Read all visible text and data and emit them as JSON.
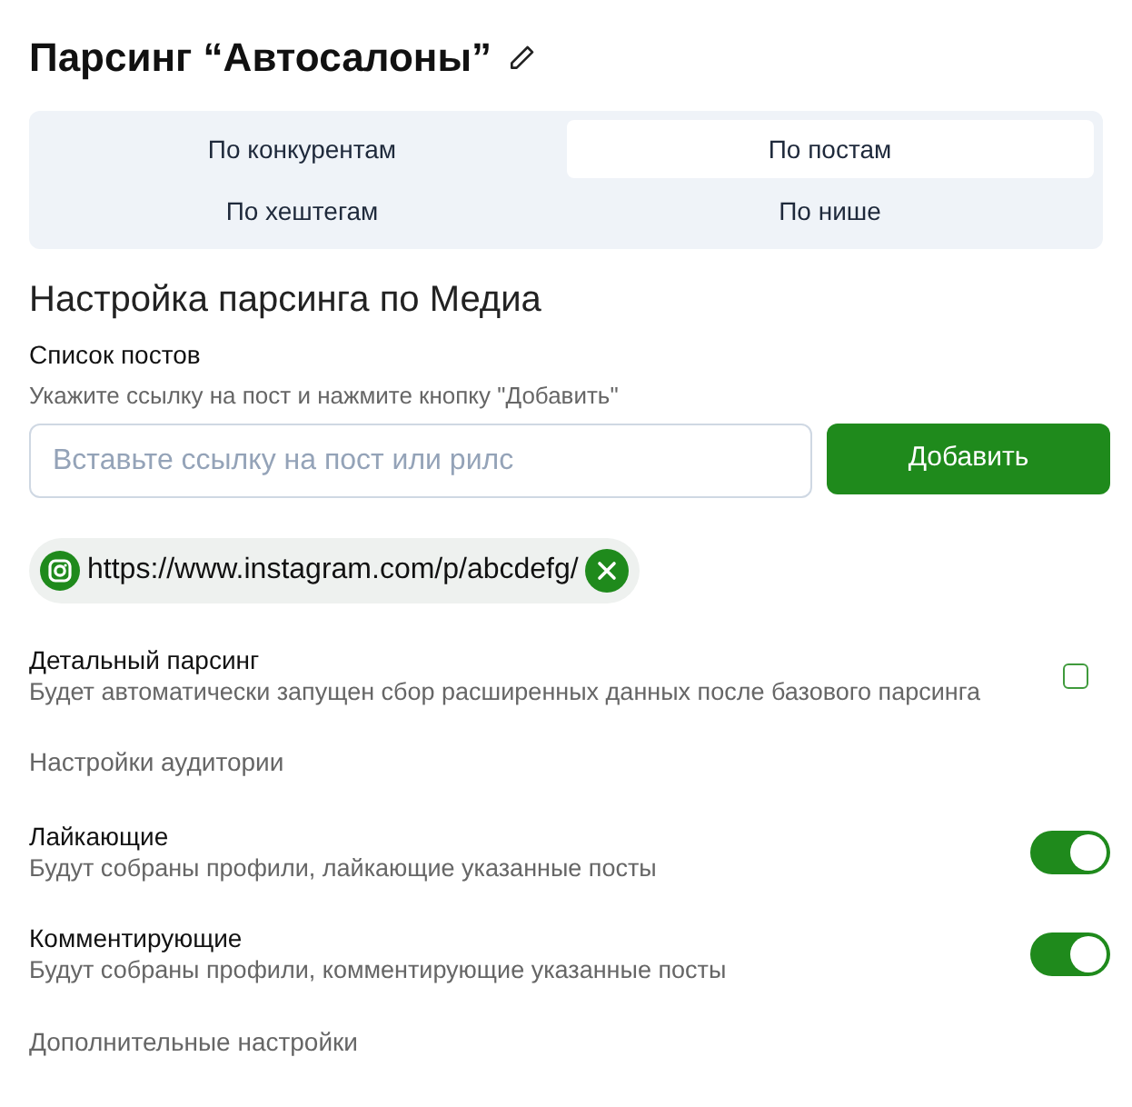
{
  "title": "Парсинг “Автосалоны”",
  "tabs": [
    {
      "label": "По конкурентам",
      "selected": false
    },
    {
      "label": "По постам",
      "selected": true
    },
    {
      "label": "По хештегам",
      "selected": false
    },
    {
      "label": "По нише",
      "selected": false
    }
  ],
  "section_title": "Настройка парсинга по Медиа",
  "posts": {
    "label": "Список постов",
    "hint": "Укажите ссылку на пост и нажмите кнопку \"Добавить\"",
    "placeholder": "Вставьте ссылку на пост или рилс",
    "add_button": "Добавить",
    "items": [
      {
        "url": "https://www.instagram.com/p/abcdefg/"
      }
    ]
  },
  "detailed": {
    "title": "Детальный парсинг",
    "description": "Будет автоматически запущен сбор расширенных данных после базового парсинга",
    "checked": false
  },
  "audience_heading": "Настройки аудитории",
  "audience": [
    {
      "title": "Лайкающие",
      "description": "Будут собраны профили, лайкающие указанные посты",
      "on": true
    },
    {
      "title": "Комментирующие",
      "description": "Будут собраны профили, комментирующие указанные посты",
      "on": true
    }
  ],
  "extra_heading": "Дополнительные настройки"
}
